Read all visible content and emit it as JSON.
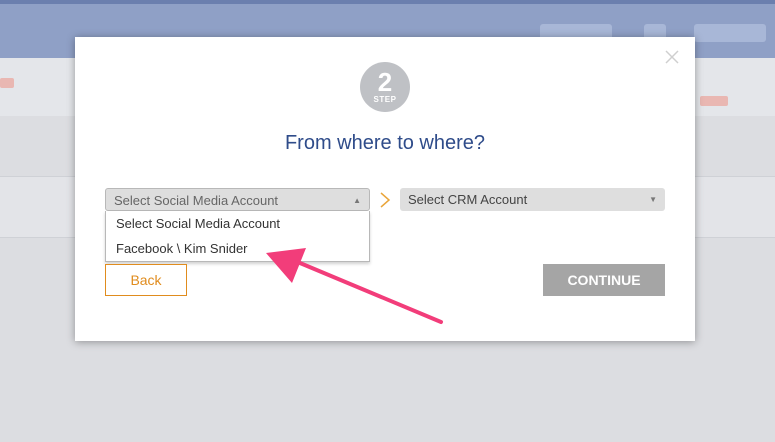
{
  "modal": {
    "step_number": "2",
    "step_label": "STEP",
    "title": "From where to where?",
    "social_select": {
      "selected": "Select Social Media Account",
      "options": [
        "Select Social Media Account",
        "Facebook \\ Kim Snider"
      ]
    },
    "crm_select": {
      "selected": "Select CRM Account"
    },
    "back_label": "Back",
    "continue_label": "CONTINUE"
  },
  "icons": {
    "close": "close-icon",
    "chevron": "chevron-right-icon",
    "caret_up": "caret-up-icon",
    "caret_down": "caret-down-icon",
    "annotation_arrow": "annotation-arrow"
  },
  "colors": {
    "title": "#2f4c8a",
    "back_accent": "#e08c1e",
    "continue_bg": "#a5a5a5",
    "annotation_arrow": "#f23d7a",
    "step_badge": "#bfc1c5"
  }
}
